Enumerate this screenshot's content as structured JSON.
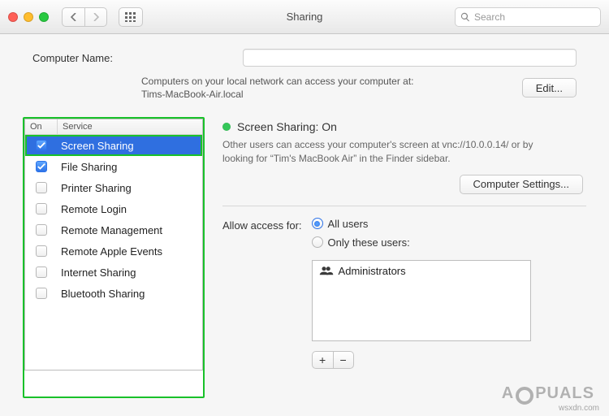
{
  "window": {
    "title": "Sharing"
  },
  "toolbar": {
    "search_placeholder": "Search"
  },
  "computer_name": {
    "label": "Computer Name:",
    "value": "",
    "help_line1": "Computers on your local network can access your computer at:",
    "help_line2": "Tims-MacBook-Air.local",
    "edit_button": "Edit..."
  },
  "services": {
    "col_on": "On",
    "col_service": "Service",
    "items": [
      {
        "label": "Screen Sharing",
        "checked": true,
        "selected": true
      },
      {
        "label": "File Sharing",
        "checked": true,
        "selected": false
      },
      {
        "label": "Printer Sharing",
        "checked": false,
        "selected": false
      },
      {
        "label": "Remote Login",
        "checked": false,
        "selected": false
      },
      {
        "label": "Remote Management",
        "checked": false,
        "selected": false
      },
      {
        "label": "Remote Apple Events",
        "checked": false,
        "selected": false
      },
      {
        "label": "Internet Sharing",
        "checked": false,
        "selected": false
      },
      {
        "label": "Bluetooth Sharing",
        "checked": false,
        "selected": false
      }
    ]
  },
  "detail": {
    "status_title": "Screen Sharing: On",
    "status_color": "#35c759",
    "description": "Other users can access your computer's screen at vnc://10.0.0.14/ or by looking for “Tim's MacBook Air” in the Finder sidebar.",
    "computer_settings_button": "Computer Settings...",
    "access_label": "Allow access for:",
    "radios": {
      "all": {
        "label": "All users",
        "selected": true
      },
      "only": {
        "label": "Only these users:",
        "selected": false
      }
    },
    "user_list": [
      "Administrators"
    ],
    "plus": "+",
    "minus": "−"
  },
  "watermark": {
    "brand_left": "A",
    "brand_right": "PUALS",
    "src": "wsxdn.com"
  }
}
